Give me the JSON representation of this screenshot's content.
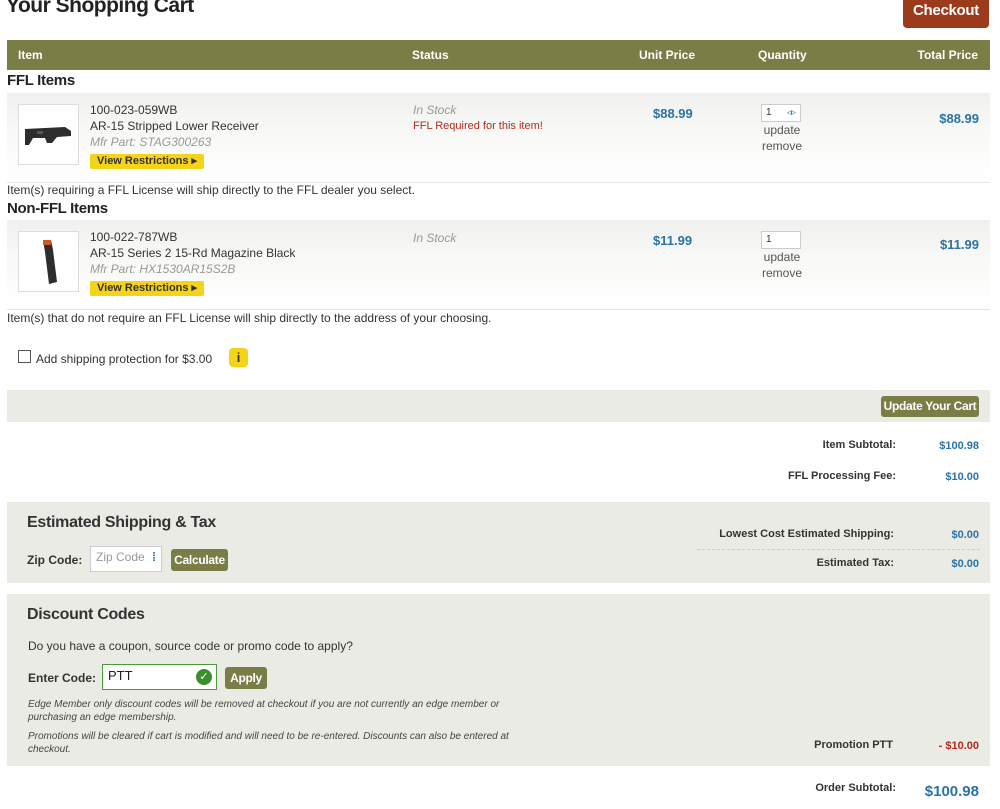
{
  "page": {
    "title": "Your Shopping Cart",
    "checkout_label": "Checkout"
  },
  "table": {
    "headers": {
      "item": "Item",
      "status": "Status",
      "unit_price": "Unit Price",
      "quantity": "Quantity",
      "total_price": "Total Price"
    }
  },
  "ffl": {
    "title": "FFL Items",
    "item": {
      "sku": "100-023-059WB",
      "name": "AR-15 Stripped Lower Receiver",
      "mfr": "Mfr Part: STAG300263",
      "restrictions": "View Restrictions",
      "status": "In Stock",
      "status_note": "FFL Required for this item!",
      "unit_price": "$88.99",
      "qty": "1",
      "update": "update",
      "remove": "remove",
      "total": "$88.99"
    },
    "note": "Item(s) requiring a FFL License will ship directly to the FFL dealer you select."
  },
  "nonffl": {
    "title": "Non-FFL Items",
    "item": {
      "sku": "100-022-787WB",
      "name": "AR-15 Series 2 15-Rd Magazine Black",
      "mfr": "Mfr Part: HX1530AR15S2B",
      "restrictions": "View Restrictions",
      "status": "In Stock",
      "unit_price": "$11.99",
      "qty": "1",
      "update": "update",
      "remove": "remove",
      "total": "$11.99"
    },
    "note": "Item(s) that do not require an FFL License will ship directly to the address of your choosing."
  },
  "protection": {
    "label": "Add shipping protection for $3.00",
    "info": "i"
  },
  "update_cart": "Update Your Cart",
  "summary": {
    "subtotal_label": "Item Subtotal:",
    "subtotal": "$100.98",
    "ffl_fee_label": "FFL Processing Fee:",
    "ffl_fee": "$10.00"
  },
  "shipping": {
    "title": "Estimated Shipping & Tax",
    "zip_label": "Zip Code:",
    "zip_placeholder": "Zip Code",
    "calculate": "Calculate",
    "lowest_label": "Lowest Cost Estimated Shipping:",
    "lowest": "$0.00",
    "tax_label": "Estimated Tax:",
    "tax": "$0.00"
  },
  "discount": {
    "title": "Discount Codes",
    "question": "Do you have a coupon, source code or promo code to apply?",
    "enter_label": "Enter Code:",
    "code": "PTT",
    "apply": "Apply",
    "note1a": "Edge Member only discount codes will be removed at checkout if you are not currently an edge member or",
    "note1b": "purchasing an edge membership.",
    "note2a": "Promotions will be cleared if cart is modified and will need to be re-entered. Discounts can also be entered at",
    "note2b": "checkout.",
    "promo_label": "Promotion PTT",
    "promo_value": "- $10.00"
  },
  "order": {
    "label": "Order Subtotal:",
    "value": "$100.98"
  },
  "colors": {
    "olive": "#7a7d46",
    "checkout": "#9c3b1c",
    "price_blue": "#2a73a7",
    "warn_red": "#b22b1b",
    "yellow": "#f5d319"
  },
  "icons": {
    "checkbox": "checkbox",
    "info": "info-icon",
    "valid": "check-circle-icon",
    "spinner": "spinner-icon"
  }
}
